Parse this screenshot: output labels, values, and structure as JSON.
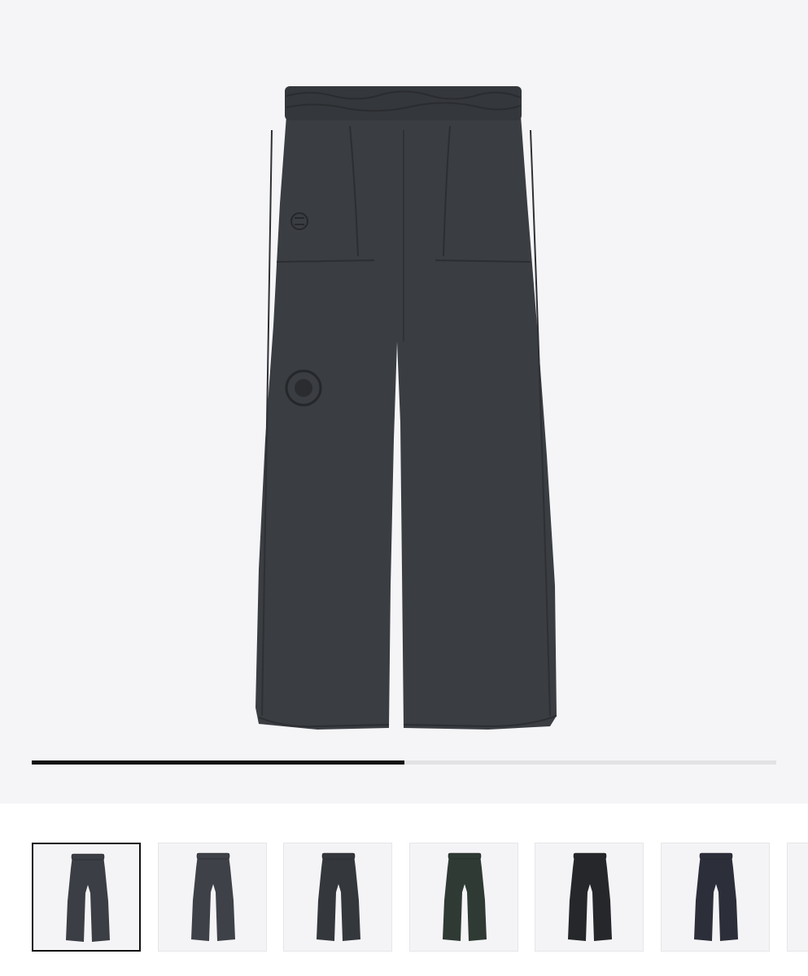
{
  "gallery": {
    "main_image": {
      "icon": "product-photo-wide-leg-pants",
      "garment_color": "#3a3d42",
      "background_color": "#f5f5f7"
    },
    "progress": {
      "fraction": 0.5,
      "fill_color": "#111111",
      "track_color": "#e2e2e4"
    },
    "selected_index": 0,
    "thumbnails": [
      {
        "color": "#3b3e44"
      },
      {
        "color": "#3e4147"
      },
      {
        "color": "#34373c"
      },
      {
        "color": "#2f3a34"
      },
      {
        "color": "#25272a"
      },
      {
        "color": "#2c2f3a"
      },
      {
        "color": "#3a3d42"
      }
    ]
  }
}
